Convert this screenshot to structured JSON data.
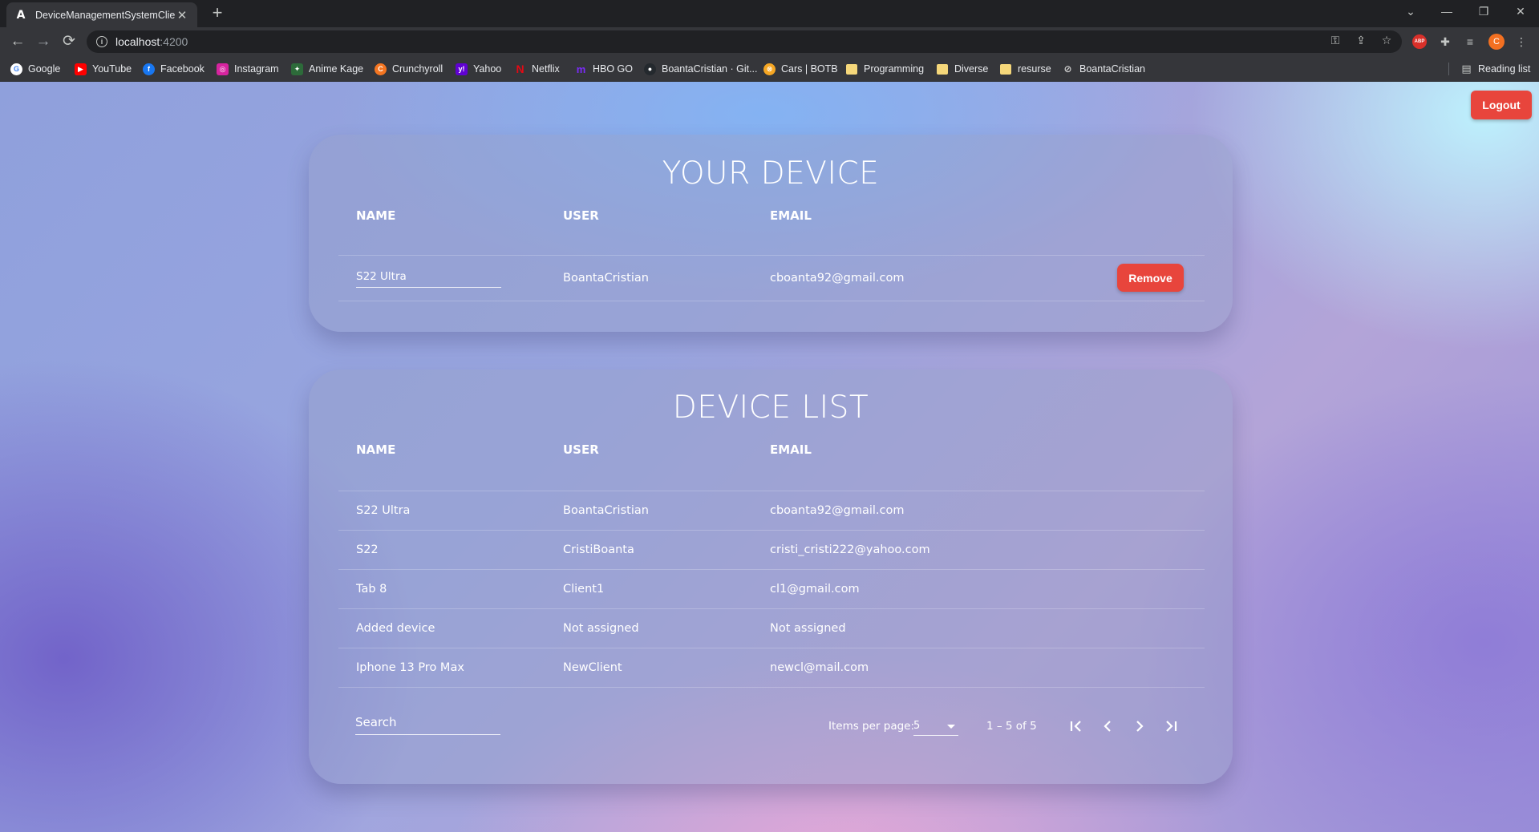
{
  "browser": {
    "tab_title": "DeviceManagementSystemClient",
    "tab_favicon": "A",
    "url_host": "localhost",
    "url_port": ":4200",
    "profile_initial": "C",
    "abp_label": "ABP",
    "bookmarks": [
      {
        "label": "Google",
        "icon": "google-icon",
        "color": "#ffffff"
      },
      {
        "label": "YouTube",
        "icon": "youtube-icon",
        "color": "#ff0000"
      },
      {
        "label": "Facebook",
        "icon": "facebook-icon",
        "color": "#1877f2"
      },
      {
        "label": "Instagram",
        "icon": "instagram-icon",
        "color": "#d6249f"
      },
      {
        "label": "Anime Kage",
        "icon": "anime-kage-icon",
        "color": "#2d6b3a"
      },
      {
        "label": "Crunchyroll",
        "icon": "crunchyroll-icon",
        "color": "#f47521"
      },
      {
        "label": "Yahoo",
        "icon": "yahoo-icon",
        "color": "#6001d2"
      },
      {
        "label": "Netflix",
        "icon": "netflix-icon",
        "color": "#e50914"
      },
      {
        "label": "HBO GO",
        "icon": "hbo-icon",
        "color": "#7b2bf9"
      },
      {
        "label": "BoantaCristian · Git...",
        "icon": "github-icon",
        "color": "#24292e"
      },
      {
        "label": "Cars | BOTB",
        "icon": "botb-icon",
        "color": "#f5a623"
      },
      {
        "label": "Programming",
        "icon": "folder-icon",
        "color": "#f5d77a"
      },
      {
        "label": "Diverse",
        "icon": "folder-icon",
        "color": "#f5d77a"
      },
      {
        "label": "resurse",
        "icon": "folder-icon",
        "color": "#f5d77a"
      },
      {
        "label": "BoantaCristian",
        "icon": "link-icon",
        "color": "#cfcfcf"
      }
    ],
    "reading_list": "Reading list"
  },
  "page": {
    "logout_label": "Logout",
    "your_device": {
      "title": "YOUR DEVICE",
      "columns": [
        "NAME",
        "USER",
        "EMAIL"
      ],
      "name_value": "S22 Ultra",
      "user": "BoantaCristian",
      "email": "cboanta92@gmail.com",
      "remove_label": "Remove"
    },
    "device_list": {
      "title": "DEVICE LIST",
      "columns": [
        "NAME",
        "USER",
        "EMAIL"
      ],
      "rows": [
        {
          "name": "S22 Ultra",
          "user": "BoantaCristian",
          "email": "cboanta92@gmail.com"
        },
        {
          "name": "S22",
          "user": "CristiBoanta",
          "email": "cristi_cristi222@yahoo.com"
        },
        {
          "name": "Tab 8",
          "user": "Client1",
          "email": "cl1@gmail.com"
        },
        {
          "name": "Added device",
          "user": "Not assigned",
          "email": "Not assigned"
        },
        {
          "name": "Iphone 13 Pro Max",
          "user": "NewClient",
          "email": "newcl@mail.com"
        }
      ],
      "search_placeholder": "Search",
      "items_per_page_label": "Items per page:",
      "items_per_page_value": "5",
      "range_label": "1 – 5 of 5"
    },
    "colors": {
      "accent_red": "#e8453c",
      "text": "#ffffff"
    }
  }
}
